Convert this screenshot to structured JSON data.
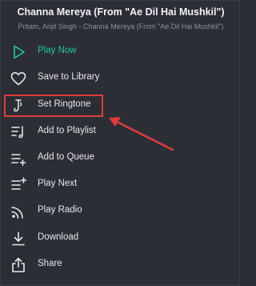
{
  "header": {
    "title": "Channa Mereya (From \"Ae Dil Hai Mushkil\")",
    "subtitle": "Pritam, Arijit Singh - Channa Mereya (From \"Ae Dil Hai Mushkil\")"
  },
  "menu": {
    "items": [
      {
        "label": "Play Now",
        "icon": "play-icon",
        "active": true
      },
      {
        "label": "Save to Library",
        "icon": "heart-icon"
      },
      {
        "label": "Set Ringtone",
        "icon": "ringtone-icon",
        "highlighted": true
      },
      {
        "label": "Add to Playlist",
        "icon": "add-to-playlist-icon"
      },
      {
        "label": "Add to Queue",
        "icon": "add-to-queue-icon"
      },
      {
        "label": "Play Next",
        "icon": "play-next-icon"
      },
      {
        "label": "Play Radio",
        "icon": "radio-icon"
      },
      {
        "label": "Download",
        "icon": "download-icon"
      },
      {
        "label": "Share",
        "icon": "share-icon"
      }
    ]
  },
  "colors": {
    "background": "#2c2e36",
    "accent": "#21c9a5",
    "text": "#e6e7ea",
    "highlight": "#e13b3b"
  }
}
